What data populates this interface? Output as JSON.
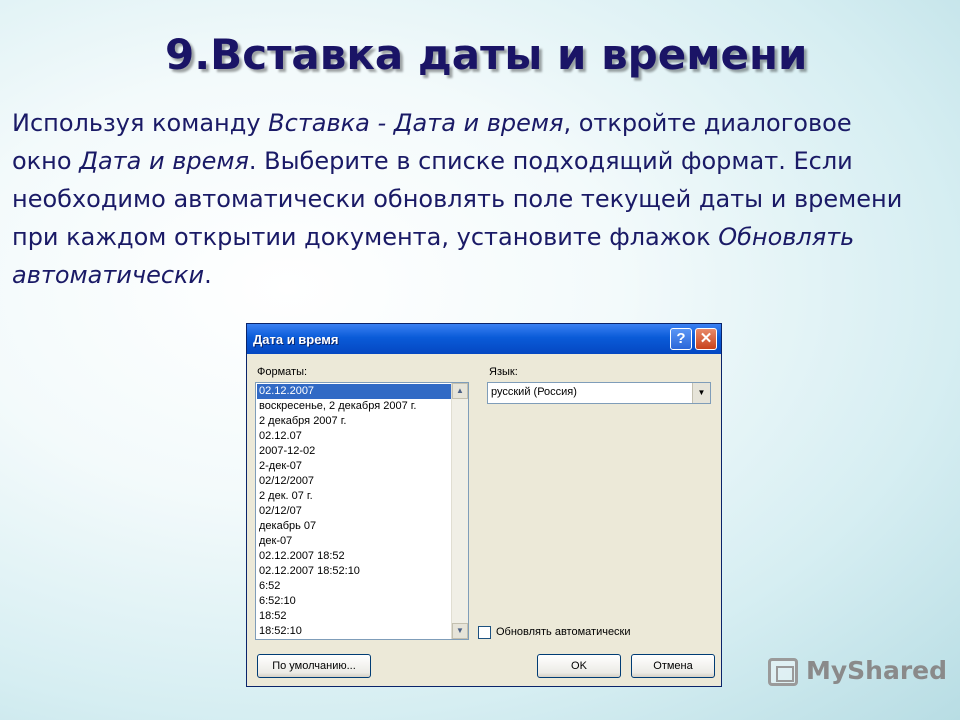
{
  "slide": {
    "title": "9.Вставка даты и времени",
    "body": {
      "t1": "Используя команду ",
      "i1": "Вставка - Дата и время",
      "t2": ", откройте диалоговое окно ",
      "i2": "Дата и время",
      "t3": ". Выберите в списке подходящий формат. Если необходимо автоматически обновлять поле текущей даты и времени при каждом открытии документа, установите флажок ",
      "i3": "Обновлять автоматически",
      "t4": "."
    }
  },
  "dialog": {
    "title": "Дата и время",
    "help_glyph": "?",
    "close_glyph": "✕",
    "formats_label": "Форматы:",
    "formats": [
      "02.12.2007",
      "воскресенье, 2 декабря 2007 г.",
      "2 декабря 2007 г.",
      "02.12.07",
      "2007-12-02",
      "2-дек-07",
      "02/12/2007",
      "2 дек. 07 г.",
      "02/12/07",
      "декабрь 07",
      "дек-07",
      "02.12.2007 18:52",
      "02.12.2007 18:52:10",
      "6:52",
      "6:52:10",
      "18:52",
      "18:52:10"
    ],
    "selected_index": 0,
    "language_label": "Язык:",
    "language_value": "русский (Россия)",
    "auto_update_label": "Обновлять автоматически",
    "auto_update_checked": false,
    "default_button": "По умолчанию...",
    "ok_button": "OK",
    "cancel_button": "Отмена"
  },
  "watermark": {
    "text": "MyShared"
  }
}
